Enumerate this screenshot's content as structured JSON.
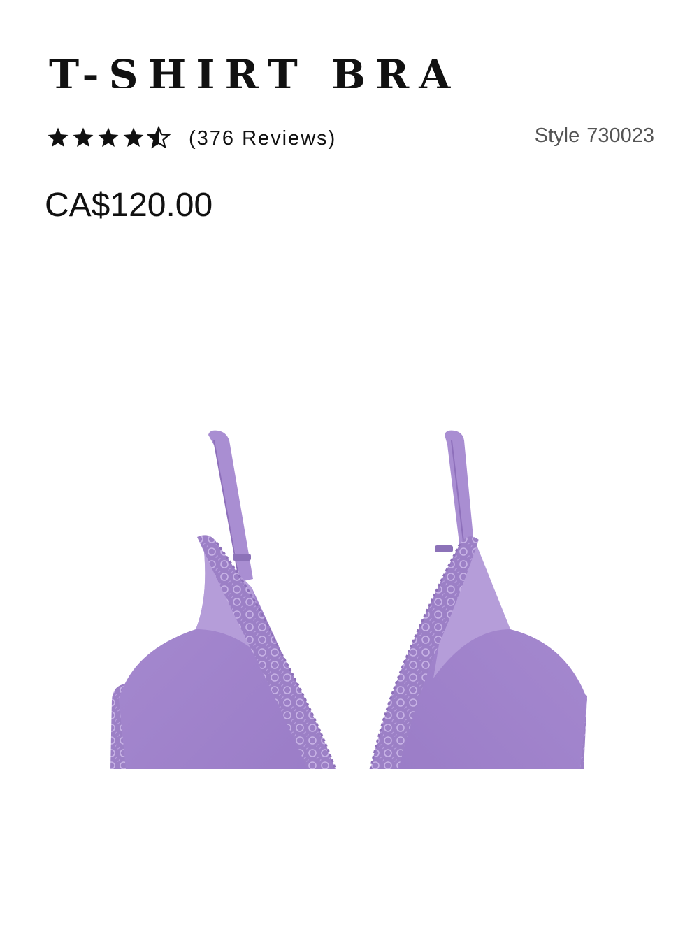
{
  "product": {
    "title": "T-SHIRT BRA",
    "rating": 4.5,
    "rating_max": 5,
    "reviews_text": "(376 Reviews)",
    "style_label": "Style",
    "style_number": "730023",
    "price": "CA$120.00",
    "image_name": "purple-lace-bra-image"
  },
  "colors": {
    "text": "#111111",
    "muted": "#555555",
    "product_lavender": "#a689cf"
  }
}
